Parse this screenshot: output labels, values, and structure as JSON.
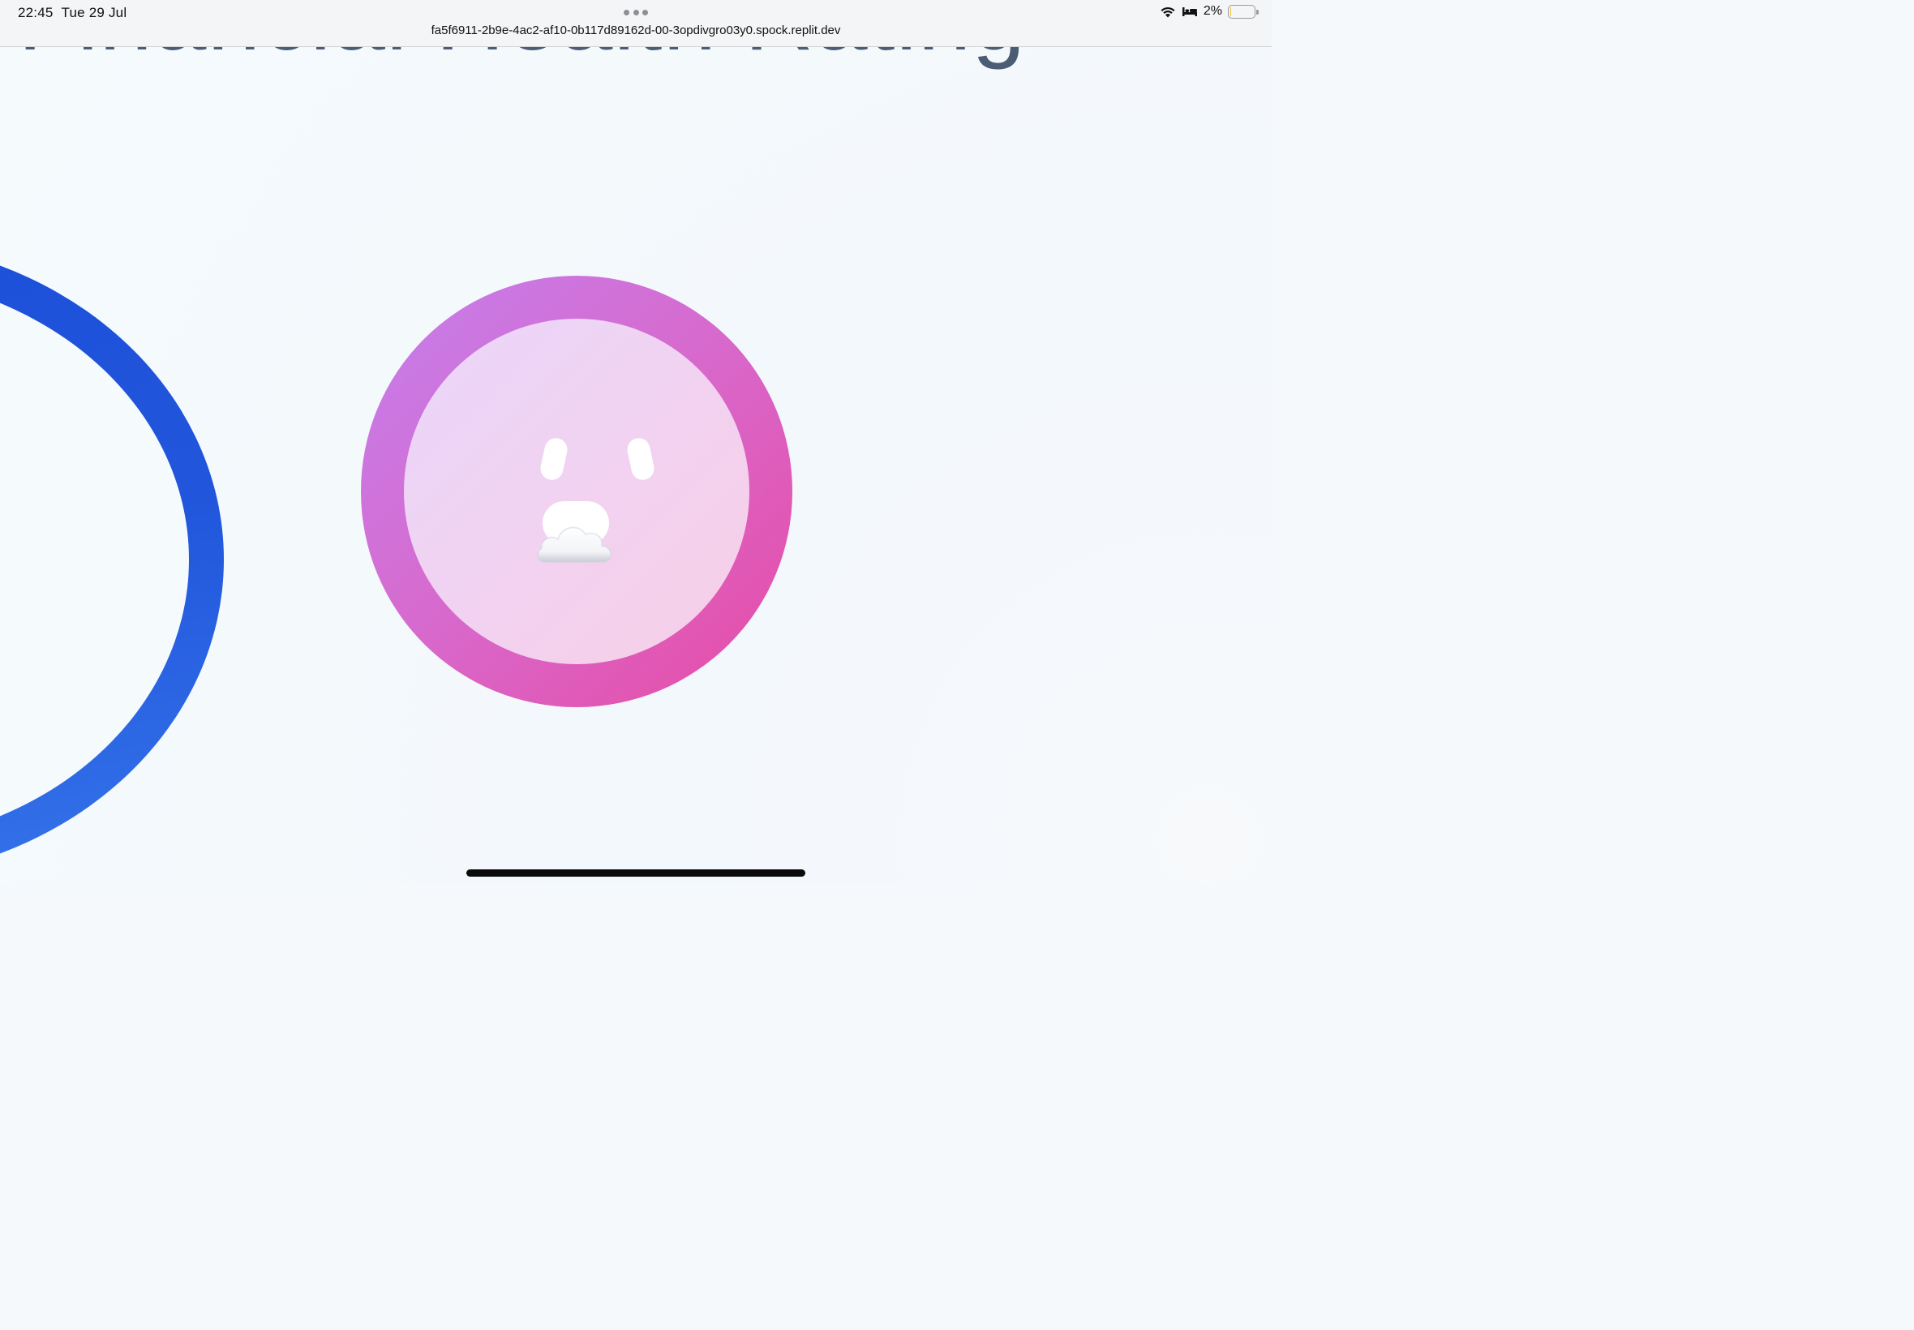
{
  "status_bar": {
    "time": "22:45",
    "date": "Tue 29 Jul",
    "battery_percent_label": "2%",
    "battery_level": 0.02
  },
  "browser": {
    "url": "fa5f6911-2b9e-4ac2-af10-0b117d89162d-00-3opdivgro03y0.spock.replit.dev",
    "more_icon": "ellipsis-icon"
  },
  "page": {
    "heading": "Financial Health Rating"
  },
  "gauge": {
    "face_icon": "surprised-face-icon",
    "emoji": "cloud-emoji-icon"
  },
  "colors": {
    "blue_ring": "#1d4ed8",
    "gauge_start": "#c47fee",
    "gauge_end": "#e84ba4",
    "heading_text": "#4a5d74"
  }
}
